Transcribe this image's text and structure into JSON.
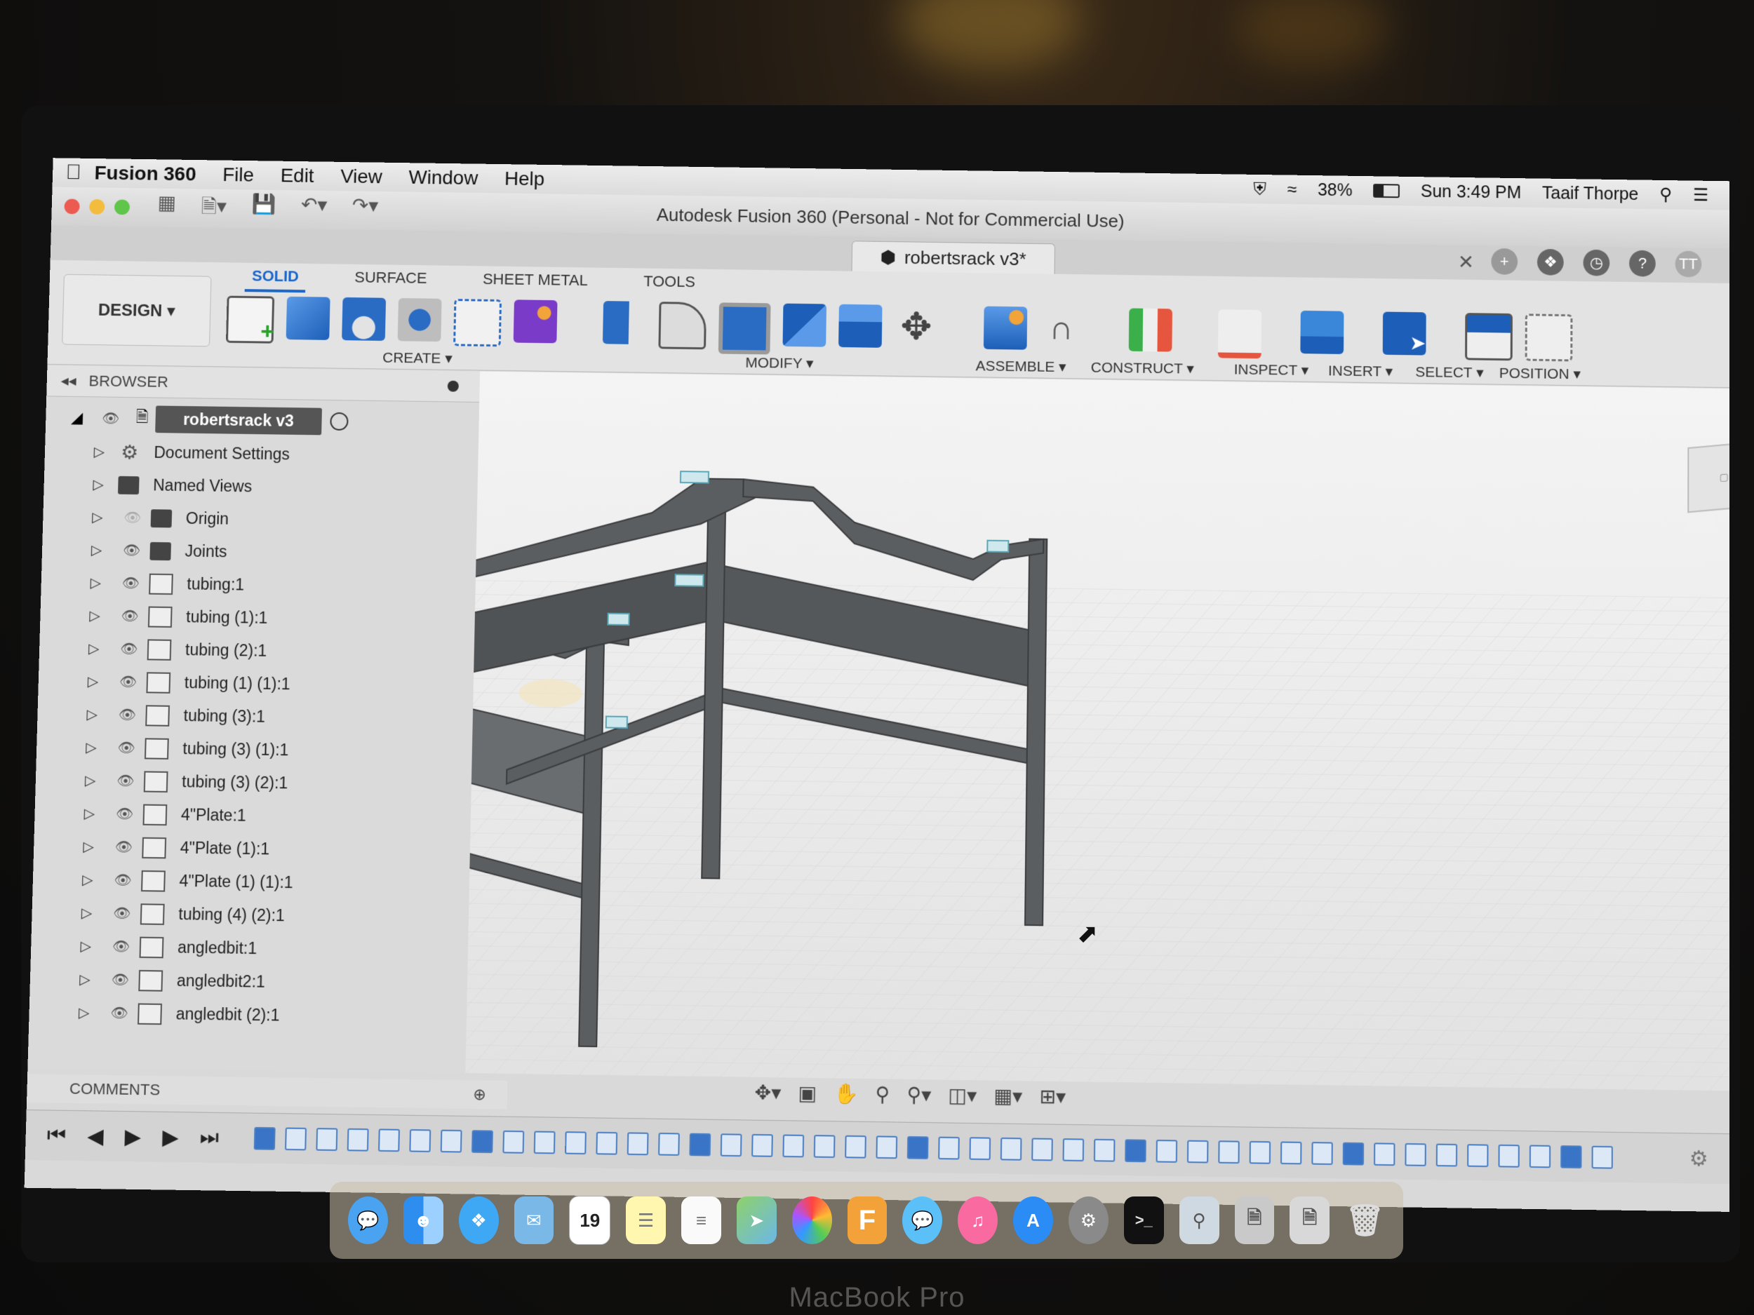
{
  "mac_menu": {
    "app_name": "Fusion 360",
    "items": [
      "File",
      "Edit",
      "View",
      "Window",
      "Help"
    ],
    "battery": "38%",
    "clock": "Sun 3:49 PM",
    "user": "Taaif Thorpe"
  },
  "window": {
    "title": "Autodesk Fusion 360 (Personal - Not for Commercial Use)",
    "doc_tab": "robertsrack v3*"
  },
  "toolbar": {
    "design_label": "DESIGN ▾",
    "tabs": [
      "SOLID",
      "SURFACE",
      "SHEET METAL",
      "TOOLS"
    ],
    "groups": [
      "CREATE ▾",
      "MODIFY ▾",
      "ASSEMBLE ▾",
      "CONSTRUCT ▾",
      "INSPECT ▾",
      "INSERT ▾",
      "SELECT ▾",
      "POSITION ▾"
    ]
  },
  "browser": {
    "title": "BROWSER",
    "root": "robertsrack v3",
    "nodes": [
      {
        "label": "Document Settings",
        "kind": "gear"
      },
      {
        "label": "Named Views",
        "kind": "folder"
      },
      {
        "label": "Origin",
        "kind": "folder"
      },
      {
        "label": "Joints",
        "kind": "folder"
      },
      {
        "label": "tubing:1",
        "kind": "component"
      },
      {
        "label": "tubing (1):1",
        "kind": "component"
      },
      {
        "label": "tubing (2):1",
        "kind": "component"
      },
      {
        "label": "tubing (1) (1):1",
        "kind": "component"
      },
      {
        "label": "tubing (3):1",
        "kind": "component"
      },
      {
        "label": "tubing (3) (1):1",
        "kind": "component"
      },
      {
        "label": "tubing (3) (2):1",
        "kind": "component"
      },
      {
        "label": "4\"Plate:1",
        "kind": "component"
      },
      {
        "label": "4\"Plate (1):1",
        "kind": "component"
      },
      {
        "label": "4\"Plate (1) (1):1",
        "kind": "component"
      },
      {
        "label": "tubing (4) (2):1",
        "kind": "component"
      },
      {
        "label": "angledbit:1",
        "kind": "component"
      },
      {
        "label": "angledbit2:1",
        "kind": "component"
      },
      {
        "label": "angledbit (2):1",
        "kind": "component"
      }
    ]
  },
  "comments": {
    "label": "COMMENTS"
  },
  "dock": {
    "calendar_day": "19"
  },
  "laptop_label": "MacBook Pro",
  "colors": {
    "accent": "#1a66c9",
    "model_gray": "#5b5e60"
  }
}
